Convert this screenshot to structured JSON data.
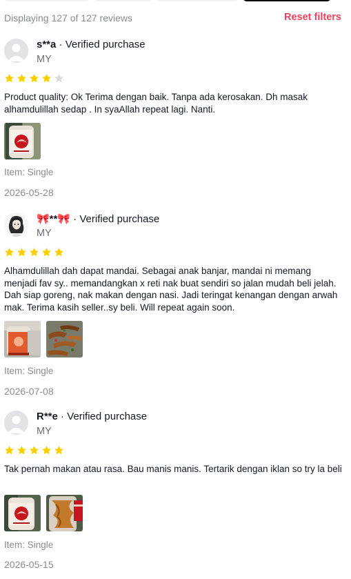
{
  "summary": {
    "text": "Displaying 127 of 127 reviews",
    "reset_label": "Reset filters"
  },
  "colors": {
    "accent": "#e9435e",
    "star_filled": "#facd00",
    "star_empty": "#dcdcdc"
  },
  "reviews": [
    {
      "username": "s**a",
      "verified": "· Verified purchase",
      "country": "MY",
      "rating": 4,
      "text": "Product quality: Ok Terima dengan baik. Tanpa ada kerosakan. Dh masak alhamdulillah sedap . In syaAllah repeat lagi. Nanti.",
      "photo_count": 1,
      "item_label": "Item:",
      "item_value": "Single",
      "date": "2026-05-28"
    },
    {
      "username": "🎀**🎀",
      "verified": "· Verified purchase",
      "country": "MY",
      "rating": 5,
      "text": "Alhamdulillah dah dapat mandai. Sebagai anak banjar, mandai ni memang menjadi fav sy.. memandangkan x reti nak buat sendiri so jalan mudah beli jelah. Dah siap goreng, nak makan dengan nasi. Jadi teringat kenangan dengan arwah mak. Terima kasih seller..sy beli. Will repeat again soon.",
      "photo_count": 2,
      "item_label": "Item:",
      "item_value": "Single",
      "date": "2026-07-08"
    },
    {
      "username": "R**e",
      "verified": "· Verified purchase",
      "country": "MY",
      "rating": 5,
      "text": "Tak pernah makan atau rasa. Bau manis manis. Tertarik dengan iklan so try la beli",
      "photo_count": 2,
      "item_label": "Item:",
      "item_value": "Single",
      "date": "2026-05-15"
    }
  ]
}
